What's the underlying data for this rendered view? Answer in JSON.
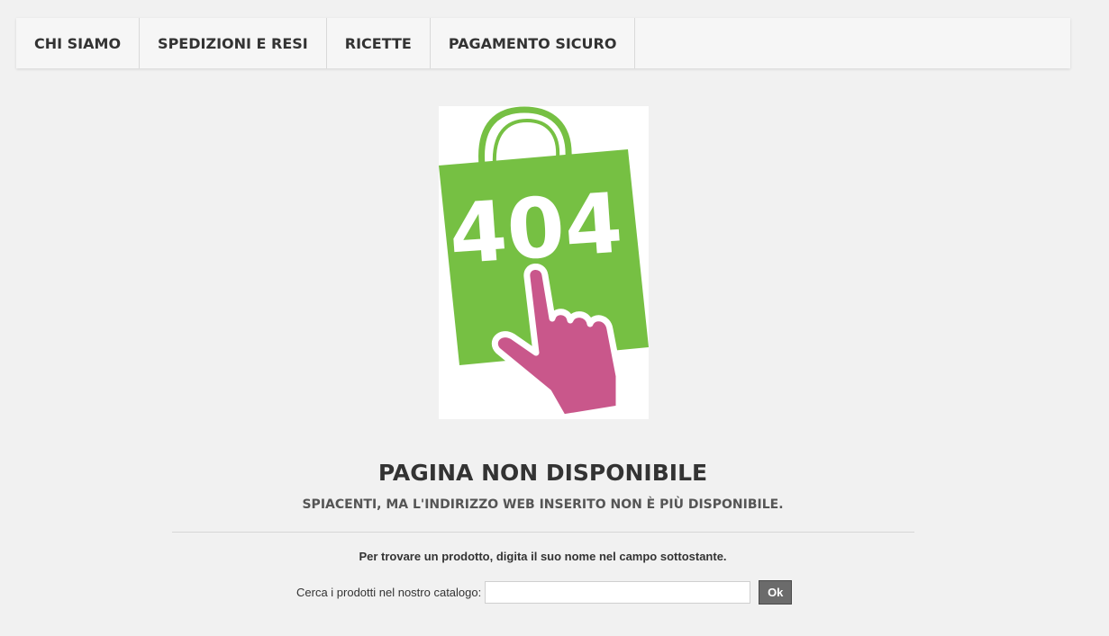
{
  "nav": {
    "items": [
      {
        "label": "CHI SIAMO"
      },
      {
        "label": "SPEDIZIONI E RESI"
      },
      {
        "label": "RICETTE"
      },
      {
        "label": "PAGAMENTO SICURO"
      }
    ]
  },
  "hero": {
    "code": "404",
    "icons": [
      "shopping-bag-icon",
      "pointing-hand-icon"
    ],
    "colors": {
      "bag": "#76c043",
      "hand": "#c9578b",
      "text": "#ffffff"
    }
  },
  "main": {
    "title": "PAGINA NON DISPONIBILE",
    "subtitle": "SPIACENTI, MA L'INDIRIZZO WEB INSERITO NON È PIÙ DISPONIBILE.",
    "hint": "Per trovare un prodotto, digita il suo nome nel campo sottostante."
  },
  "search": {
    "label": "Cerca i prodotti nel nostro catalogo:",
    "value": "",
    "placeholder": "",
    "button_label": "Ok"
  }
}
